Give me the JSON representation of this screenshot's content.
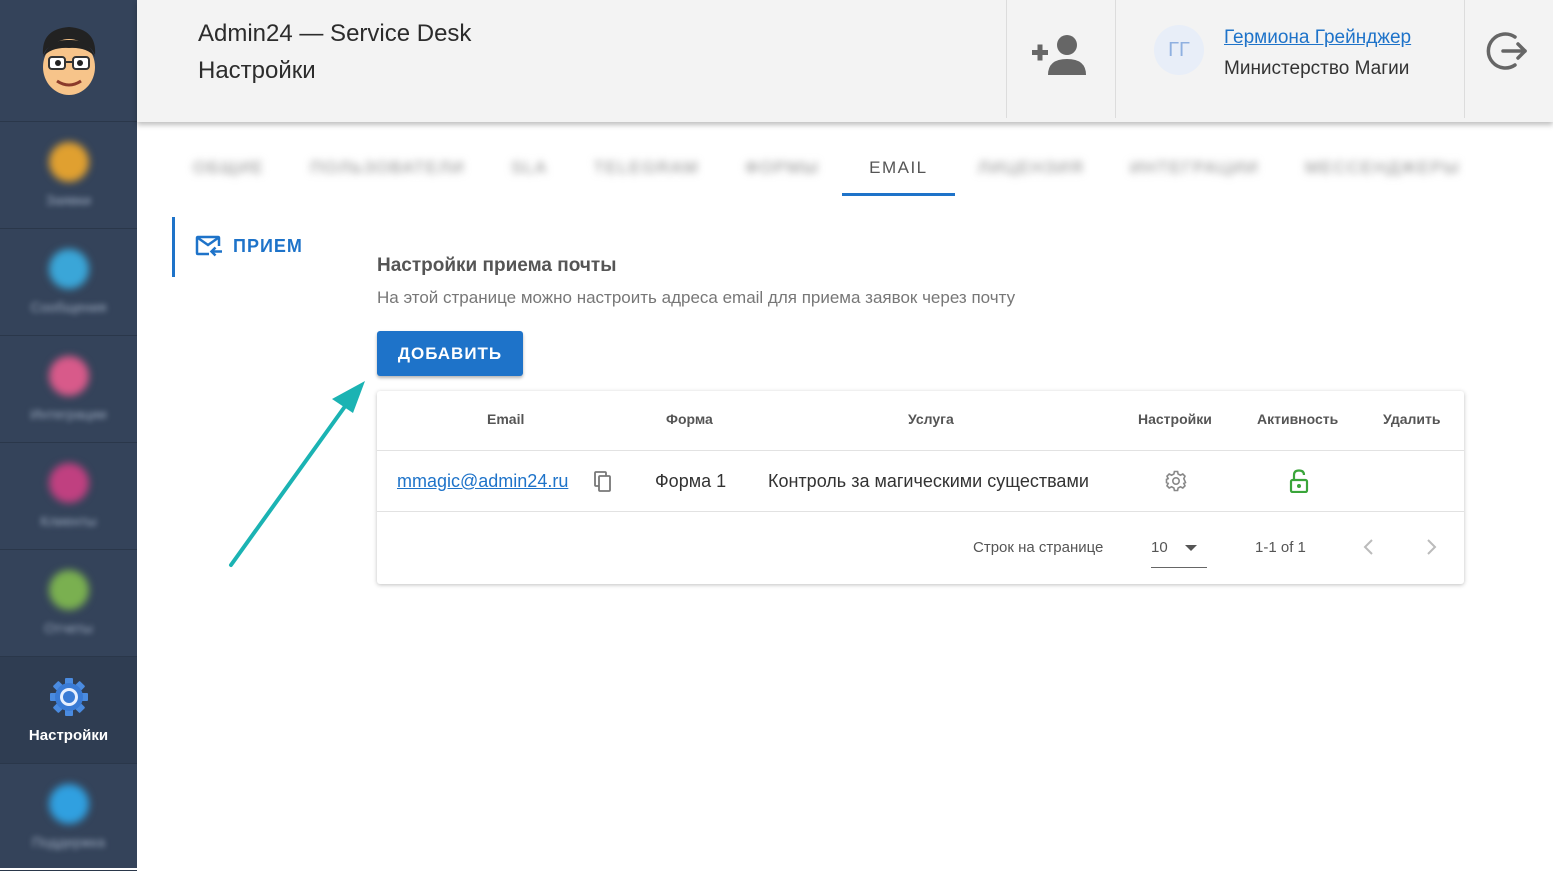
{
  "sidebar": {
    "items": [
      {
        "label": "Заявки",
        "icon": "megaphone-icon",
        "color": "#e0a030"
      },
      {
        "label": "Сообщения",
        "icon": "chat-bubbles-icon",
        "color": "#3aa6d8"
      },
      {
        "label": "Интеграции",
        "icon": "puzzle-icon",
        "color": "#d85a8a"
      },
      {
        "label": "Клиенты",
        "icon": "users-icon",
        "color": "#c04080"
      },
      {
        "label": "Отчеты",
        "icon": "report-icon",
        "color": "#7ab050"
      },
      {
        "label": "Настройки",
        "icon": "gear-icon",
        "color": "#3a7bd5"
      },
      {
        "label": "Поддержка",
        "icon": "support-icon",
        "color": "#30a0e0"
      }
    ]
  },
  "header": {
    "app_title": "Admin24 — Service Desk",
    "page_title": "Настройки",
    "user": {
      "initials": "ГГ",
      "name": "Гермиона Грейнджер",
      "organization": "Министерство Магии"
    }
  },
  "tabs": [
    {
      "label": "ОБЩИЕ",
      "blurred": true
    },
    {
      "label": "ПОЛЬЗОВАТЕЛИ",
      "blurred": true
    },
    {
      "label": "SLA",
      "blurred": true
    },
    {
      "label": "TELEGRAM",
      "blurred": true
    },
    {
      "label": "ФОРМЫ",
      "blurred": true
    },
    {
      "label": "EMAIL",
      "blurred": false,
      "active": true
    },
    {
      "label": "ЛИЦЕНЗИЯ",
      "blurred": true
    },
    {
      "label": "ИНТЕГРАЦИИ",
      "blurred": true
    },
    {
      "label": "МЕССЕНДЖЕРЫ",
      "blurred": true
    }
  ],
  "sub_nav": {
    "label": "ПРИЕМ"
  },
  "section": {
    "title": "Настройки приема почты",
    "description": "На этой странице можно настроить адреса email для приема заявок через почту",
    "add_button": "ДОБАВИТЬ"
  },
  "table": {
    "headers": {
      "email": "Email",
      "form": "Форма",
      "service": "Услуга",
      "settings": "Настройки",
      "active": "Активность",
      "delete": "Удалить"
    },
    "rows": [
      {
        "email": "mmagic@admin24.ru",
        "form": "Форма 1",
        "service": "Контроль за магическими существами"
      }
    ],
    "footer": {
      "rows_per_page_label": "Строк на странице",
      "rows_per_page": "10",
      "range": "1-1 of 1"
    }
  },
  "colors": {
    "accent": "#1e73c9",
    "sidebar_bg": "#34435a",
    "active_lock": "#3aa53a",
    "annotation_arrow": "#1bb3b3"
  }
}
